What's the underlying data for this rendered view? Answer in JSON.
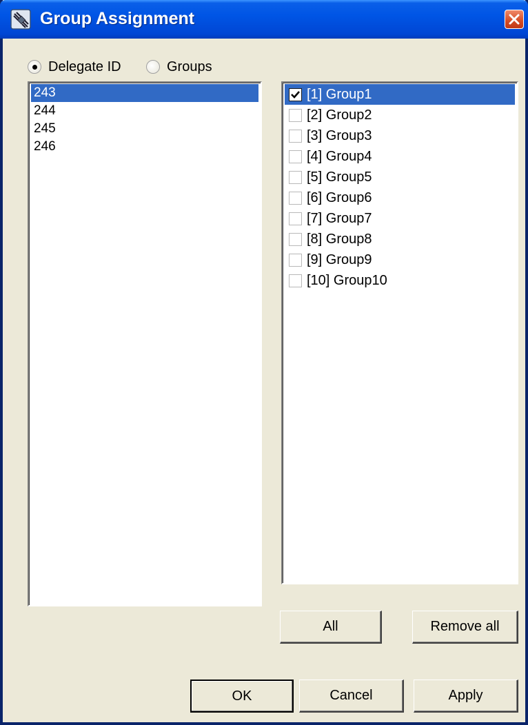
{
  "window": {
    "title": "Group Assignment"
  },
  "mode": {
    "options": [
      {
        "label": "Delegate ID",
        "checked": true
      },
      {
        "label": "Groups",
        "checked": false
      }
    ]
  },
  "delegates": {
    "items": [
      "243",
      "244",
      "245",
      "246"
    ],
    "selected_index": 0
  },
  "groups": {
    "items": [
      {
        "label": "[1] Group1",
        "checked": true
      },
      {
        "label": "[2] Group2",
        "checked": false
      },
      {
        "label": "[3] Group3",
        "checked": false
      },
      {
        "label": "[4] Group4",
        "checked": false
      },
      {
        "label": "[5] Group5",
        "checked": false
      },
      {
        "label": "[6] Group6",
        "checked": false
      },
      {
        "label": "[7] Group7",
        "checked": false
      },
      {
        "label": "[8] Group8",
        "checked": false
      },
      {
        "label": "[9] Group9",
        "checked": false
      },
      {
        "label": "[10] Group10",
        "checked": false
      }
    ],
    "selected_index": 0
  },
  "buttons": {
    "all": "All",
    "remove_all": "Remove all",
    "ok": "OK",
    "cancel": "Cancel",
    "apply": "Apply"
  },
  "colors": {
    "titlebar": "#0055e5",
    "selection": "#316ac5",
    "dialog_bg": "#ece9d8"
  }
}
